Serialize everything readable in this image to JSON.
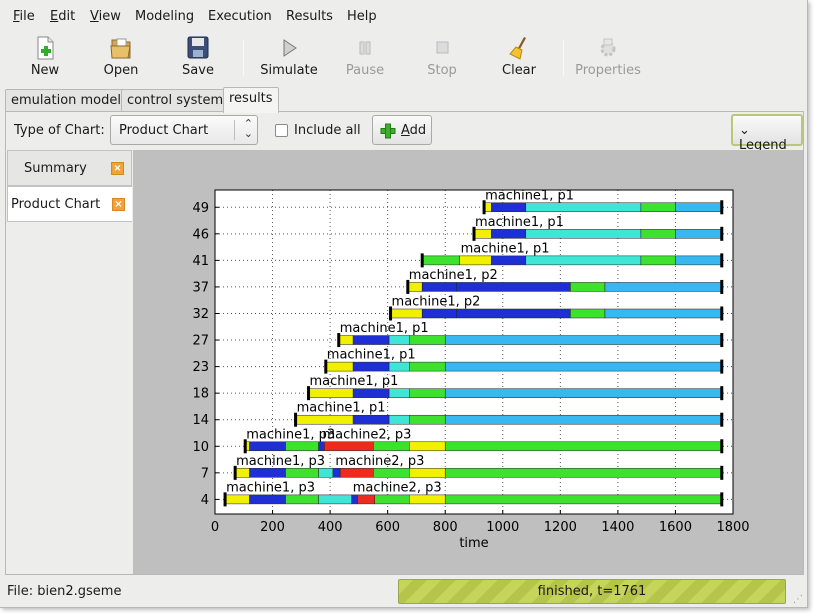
{
  "menubar": [
    {
      "label": "File",
      "mn": "F",
      "rest": "ile"
    },
    {
      "label": "Edit",
      "mn": "E",
      "rest": "dit"
    },
    {
      "label": "View",
      "mn": "V",
      "rest": "iew"
    },
    {
      "label": "Modeling",
      "mn": "",
      "rest": "Modeling"
    },
    {
      "label": "Execution",
      "mn": "",
      "rest": "Execution"
    },
    {
      "label": "Results",
      "mn": "",
      "rest": "Results"
    },
    {
      "label": "Help",
      "mn": "",
      "rest": "Help"
    }
  ],
  "toolbar": {
    "new": "New",
    "open": "Open",
    "save": "Save",
    "simulate": "Simulate",
    "pause": "Pause",
    "stop": "Stop",
    "clear": "Clear",
    "properties": "Properties"
  },
  "tabs": [
    "emulation model",
    "control system",
    "results"
  ],
  "options": {
    "type_label": "Type of Chart:",
    "chart_type": "Product Chart",
    "include_all": "Include all",
    "include_all_checked": false,
    "add_label": "Add",
    "add_mn": "A",
    "legend_label": "Legend"
  },
  "sidetabs": [
    "Summary",
    "Product Chart"
  ],
  "status": {
    "file": "File: bien2.gseme",
    "progress_text": "finished, t=1761",
    "progress": 1.0
  },
  "colors": {
    "yellow": "#f0f000",
    "blue": "#1f2fd6",
    "green": "#3ce22e",
    "cyan": "#3fe6d6",
    "lightblue": "#38b8f0",
    "red": "#ee2b1f"
  },
  "chart_data": {
    "type": "gantt",
    "xlabel": "time",
    "xlim": [
      0,
      1800
    ],
    "xticks": [
      0,
      200,
      400,
      600,
      800,
      1000,
      1200,
      1400,
      1600,
      1800
    ],
    "yticks": [
      "4",
      "7",
      "10",
      "14",
      "18",
      "23",
      "27",
      "32",
      "37",
      "41",
      "46",
      "49"
    ],
    "grid": true,
    "rows": [
      {
        "product": "4",
        "start": 35,
        "end": 1761,
        "segments": [
          [
            35,
            120,
            "yellow"
          ],
          [
            120,
            245,
            "blue"
          ],
          [
            245,
            360,
            "green"
          ],
          [
            360,
            475,
            "cyan"
          ],
          [
            475,
            495,
            "blue"
          ],
          [
            495,
            555,
            "red"
          ],
          [
            555,
            675,
            "green"
          ],
          [
            675,
            800,
            "yellow"
          ],
          [
            800,
            1761,
            "green"
          ]
        ],
        "labels": [
          {
            "text": "machine1, p3",
            "x": 35
          },
          {
            "text": "machine2, p3",
            "x": 475
          }
        ]
      },
      {
        "product": "7",
        "start": 70,
        "end": 1761,
        "segments": [
          [
            70,
            120,
            "yellow"
          ],
          [
            120,
            245,
            "blue"
          ],
          [
            245,
            360,
            "green"
          ],
          [
            360,
            410,
            "cyan"
          ],
          [
            410,
            435,
            "blue"
          ],
          [
            435,
            550,
            "red"
          ],
          [
            550,
            675,
            "green"
          ],
          [
            675,
            800,
            "yellow"
          ],
          [
            800,
            1761,
            "green"
          ]
        ],
        "labels": [
          {
            "text": "machine1, p3",
            "x": 70
          },
          {
            "text": "machine2, p3",
            "x": 415
          }
        ]
      },
      {
        "product": "10",
        "start": 105,
        "end": 1761,
        "segments": [
          [
            105,
            120,
            "yellow"
          ],
          [
            120,
            245,
            "blue"
          ],
          [
            245,
            360,
            "green"
          ],
          [
            360,
            380,
            "blue"
          ],
          [
            380,
            550,
            "red"
          ],
          [
            550,
            675,
            "green"
          ],
          [
            675,
            800,
            "yellow"
          ],
          [
            800,
            1761,
            "green"
          ]
        ],
        "labels": [
          {
            "text": "machine1, p3",
            "x": 105
          },
          {
            "text": "machine2, p3",
            "x": 370
          }
        ]
      },
      {
        "product": "14",
        "start": 280,
        "end": 1761,
        "segments": [
          [
            280,
            480,
            "yellow"
          ],
          [
            480,
            605,
            "blue"
          ],
          [
            605,
            675,
            "cyan"
          ],
          [
            675,
            800,
            "green"
          ],
          [
            800,
            1761,
            "lightblue"
          ]
        ],
        "labels": [
          {
            "text": "machine1, p1",
            "x": 280
          }
        ]
      },
      {
        "product": "18",
        "start": 325,
        "end": 1761,
        "segments": [
          [
            325,
            480,
            "yellow"
          ],
          [
            480,
            605,
            "blue"
          ],
          [
            605,
            675,
            "cyan"
          ],
          [
            675,
            800,
            "green"
          ],
          [
            800,
            1761,
            "lightblue"
          ]
        ],
        "labels": [
          {
            "text": "machine1, p1",
            "x": 325
          }
        ]
      },
      {
        "product": "23",
        "start": 385,
        "end": 1761,
        "segments": [
          [
            385,
            480,
            "yellow"
          ],
          [
            480,
            605,
            "blue"
          ],
          [
            605,
            675,
            "cyan"
          ],
          [
            675,
            800,
            "green"
          ],
          [
            800,
            1761,
            "lightblue"
          ]
        ],
        "labels": [
          {
            "text": "machine1, p1",
            "x": 385
          }
        ]
      },
      {
        "product": "27",
        "start": 430,
        "end": 1761,
        "segments": [
          [
            430,
            480,
            "yellow"
          ],
          [
            480,
            605,
            "blue"
          ],
          [
            605,
            675,
            "cyan"
          ],
          [
            675,
            800,
            "green"
          ],
          [
            800,
            1761,
            "lightblue"
          ]
        ],
        "labels": [
          {
            "text": "machine1, p1",
            "x": 430
          }
        ]
      },
      {
        "product": "32",
        "start": 610,
        "end": 1761,
        "segments": [
          [
            610,
            720,
            "yellow"
          ],
          [
            720,
            840,
            "blue"
          ],
          [
            840,
            1235,
            "blue"
          ],
          [
            1235,
            1355,
            "green"
          ],
          [
            1355,
            1761,
            "lightblue"
          ]
        ],
        "labels": [
          {
            "text": "machine1, p2",
            "x": 610
          }
        ]
      },
      {
        "product": "37",
        "start": 670,
        "end": 1761,
        "segments": [
          [
            670,
            720,
            "yellow"
          ],
          [
            720,
            840,
            "blue"
          ],
          [
            840,
            1235,
            "blue"
          ],
          [
            1235,
            1355,
            "green"
          ],
          [
            1355,
            1761,
            "lightblue"
          ]
        ],
        "labels": [
          {
            "text": "machine1, p2",
            "x": 670
          }
        ]
      },
      {
        "product": "41",
        "start": 720,
        "end": 1761,
        "segments": [
          [
            720,
            850,
            "green"
          ],
          [
            850,
            960,
            "yellow"
          ],
          [
            960,
            1080,
            "blue"
          ],
          [
            1080,
            1480,
            "cyan"
          ],
          [
            1480,
            1600,
            "green"
          ],
          [
            1600,
            1761,
            "lightblue"
          ]
        ],
        "labels": [
          {
            "text": "machine1, p1",
            "x": 850
          }
        ]
      },
      {
        "product": "46",
        "start": 900,
        "end": 1761,
        "segments": [
          [
            900,
            960,
            "yellow"
          ],
          [
            960,
            1080,
            "blue"
          ],
          [
            1080,
            1480,
            "cyan"
          ],
          [
            1480,
            1600,
            "green"
          ],
          [
            1600,
            1761,
            "lightblue"
          ]
        ],
        "labels": [
          {
            "text": "machine1, p1",
            "x": 900
          }
        ]
      },
      {
        "product": "49",
        "start": 935,
        "end": 1761,
        "segments": [
          [
            935,
            960,
            "yellow"
          ],
          [
            960,
            1080,
            "blue"
          ],
          [
            1080,
            1480,
            "cyan"
          ],
          [
            1480,
            1600,
            "green"
          ],
          [
            1600,
            1761,
            "lightblue"
          ]
        ],
        "labels": [
          {
            "text": "machine1, p1",
            "x": 935
          }
        ]
      }
    ]
  }
}
